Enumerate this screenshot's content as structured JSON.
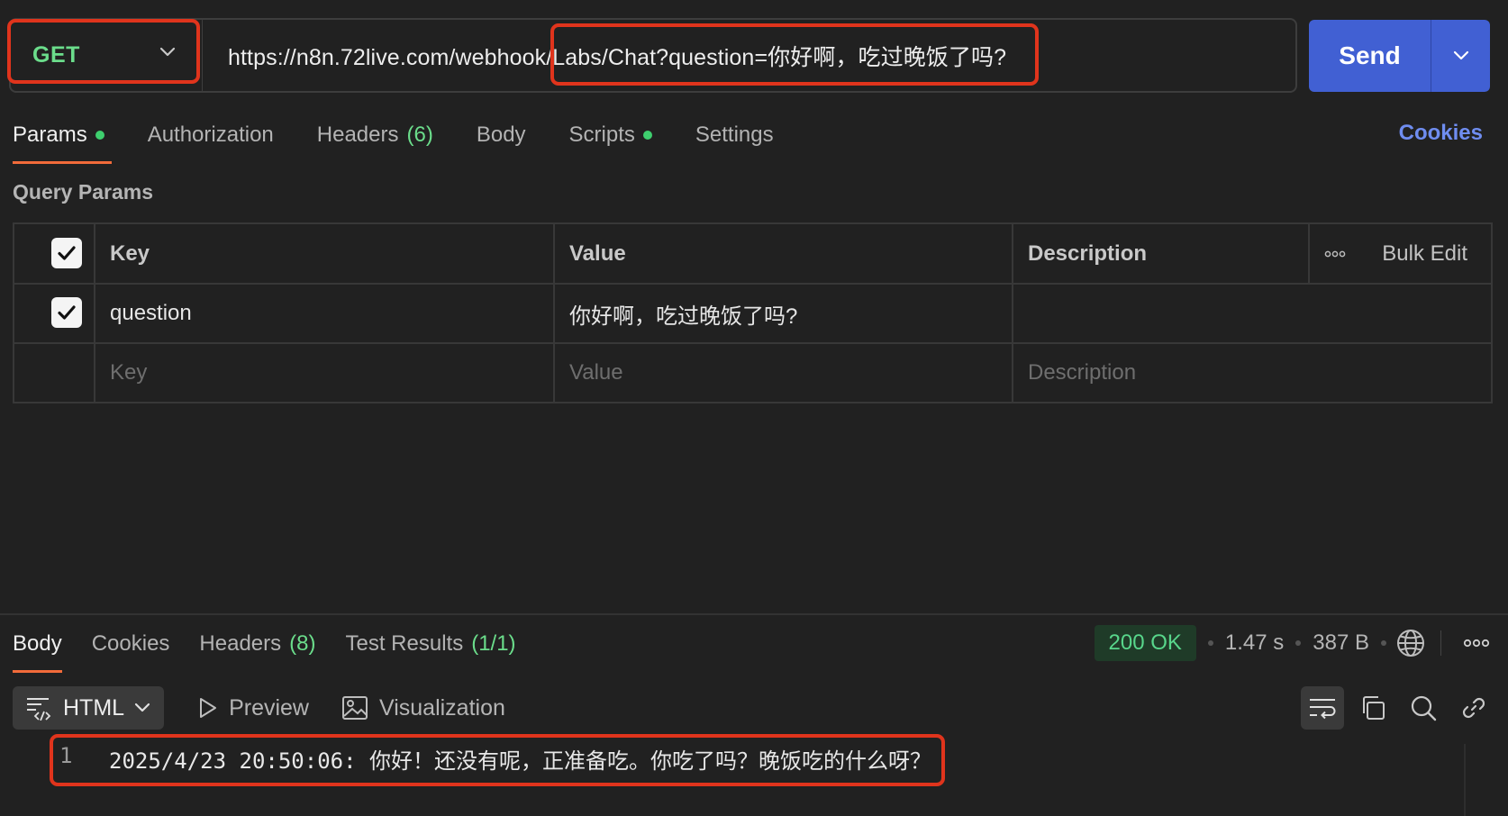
{
  "request": {
    "method": "GET",
    "url": "https://n8n.72live.com/webhook/Labs/Chat?question=你好啊，吃过晚饭了吗?",
    "send_label": "Send"
  },
  "request_tabs": [
    {
      "label": "Params",
      "dot": true,
      "active": true
    },
    {
      "label": "Authorization"
    },
    {
      "label": "Headers",
      "count": "(6)"
    },
    {
      "label": "Body"
    },
    {
      "label": "Scripts",
      "dot": true
    },
    {
      "label": "Settings"
    }
  ],
  "cookies_link": "Cookies",
  "query_params": {
    "title": "Query Params",
    "headers": {
      "key": "Key",
      "value": "Value",
      "description": "Description",
      "bulk_edit": "Bulk Edit"
    },
    "rows": [
      {
        "checked": true,
        "key": "question",
        "value": "你好啊，吃过晚饭了吗?",
        "description": ""
      }
    ],
    "placeholder": {
      "key": "Key",
      "value": "Value",
      "description": "Description"
    }
  },
  "response_tabs": [
    {
      "label": "Body",
      "active": true
    },
    {
      "label": "Cookies"
    },
    {
      "label": "Headers",
      "count": "(8)"
    },
    {
      "label": "Test Results",
      "count": "(1/1)"
    }
  ],
  "response_meta": {
    "status": "200 OK",
    "time": "1.47 s",
    "size": "387 B"
  },
  "response_format": {
    "selected": "HTML",
    "preview": "Preview",
    "visualization": "Visualization"
  },
  "response_body": [
    {
      "line": "1",
      "text": "2025/4/23 20:50:06: 你好！还没有呢，正准备吃。你吃了吗？晚饭吃的什么呀？"
    }
  ],
  "colors": {
    "accent_send": "#4160d3",
    "method_get": "#6bdd8b",
    "tab_underline": "#f26b3a",
    "highlight_box": "#e0341c",
    "status_ok": "#58d68b"
  }
}
